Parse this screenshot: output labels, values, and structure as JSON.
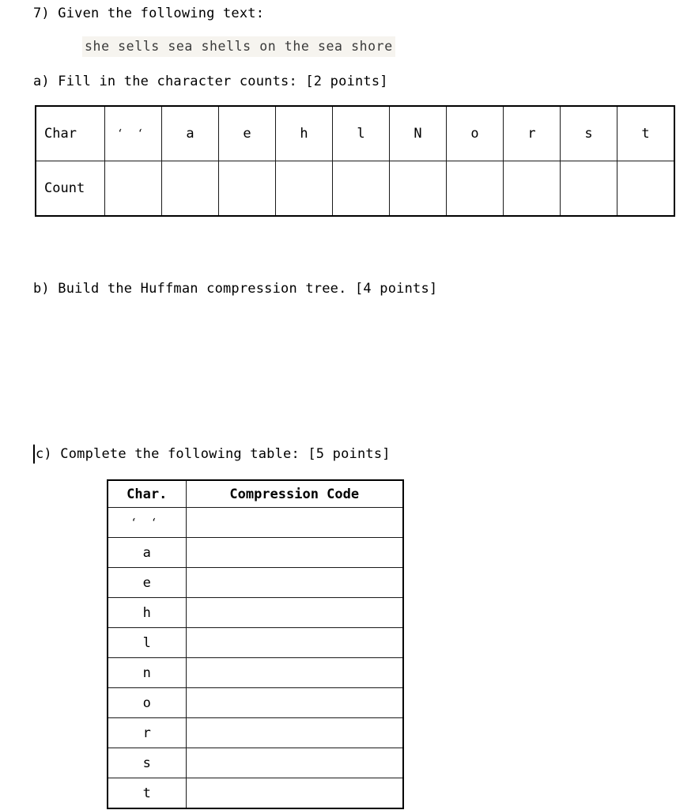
{
  "document": {
    "question_number": "7)",
    "intro_line": "7) Given the following text:",
    "sample_text": "she sells sea shells on the sea shore",
    "part_a": "a) Fill in the character counts: [2 points]",
    "part_b": "b) Build the Huffman compression tree. [4 points]",
    "part_c": "c) Complete the following table: [5 points]",
    "caret_visible": true,
    "highlight_color": "#f6f4ef",
    "text_color": "#000000",
    "border_color": "#1a1a1a"
  },
  "counts_table": {
    "row_labels": [
      "Char",
      "Count"
    ],
    "characters": [
      "' '",
      "a",
      "e",
      "h",
      "l",
      "N",
      "o",
      "r",
      "s",
      "t"
    ],
    "counts": [
      "",
      "",
      "",
      "",
      "",
      "",
      "",
      "",
      "",
      ""
    ]
  },
  "codes_table": {
    "headers": [
      "Char.",
      "Compression Code"
    ],
    "rows": [
      {
        "char": "' '",
        "code": ""
      },
      {
        "char": "a",
        "code": ""
      },
      {
        "char": "e",
        "code": ""
      },
      {
        "char": "h",
        "code": ""
      },
      {
        "char": "l",
        "code": ""
      },
      {
        "char": "n",
        "code": ""
      },
      {
        "char": "o",
        "code": ""
      },
      {
        "char": "r",
        "code": ""
      },
      {
        "char": "s",
        "code": ""
      },
      {
        "char": "t",
        "code": ""
      }
    ]
  }
}
